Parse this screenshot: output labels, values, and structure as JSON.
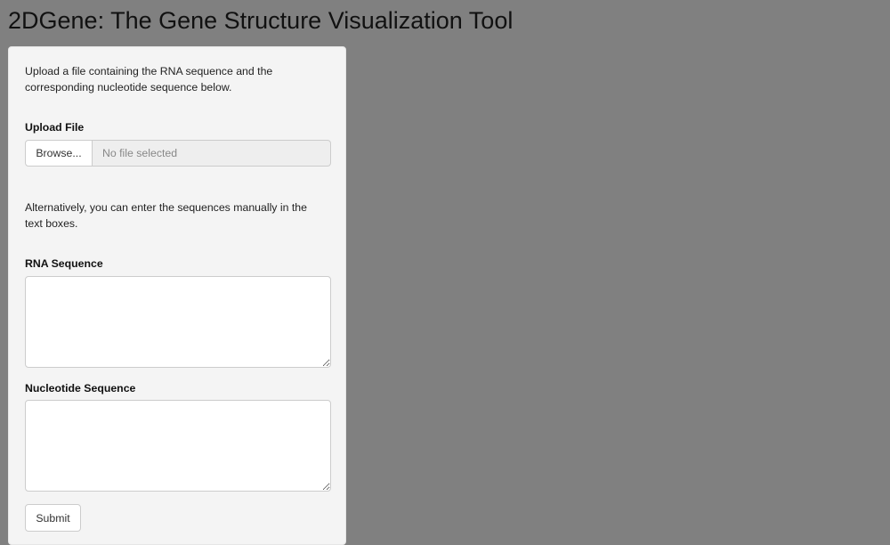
{
  "page": {
    "title": "2DGene: The Gene Structure Visualization Tool"
  },
  "form": {
    "intro_text": "Upload a file containing the RNA sequence and the corresponding nucleotide sequence below.",
    "upload": {
      "label": "Upload File",
      "browse_label": "Browse...",
      "file_status": "No file selected"
    },
    "alt_text": "Alternatively, you can enter the sequences manually in the text boxes.",
    "rna": {
      "label": "RNA Sequence",
      "value": ""
    },
    "nucleotide": {
      "label": "Nucleotide Sequence",
      "value": ""
    },
    "submit_label": "Submit"
  },
  "colors": {
    "background": "#808080",
    "panel": "#f4f4f4"
  }
}
